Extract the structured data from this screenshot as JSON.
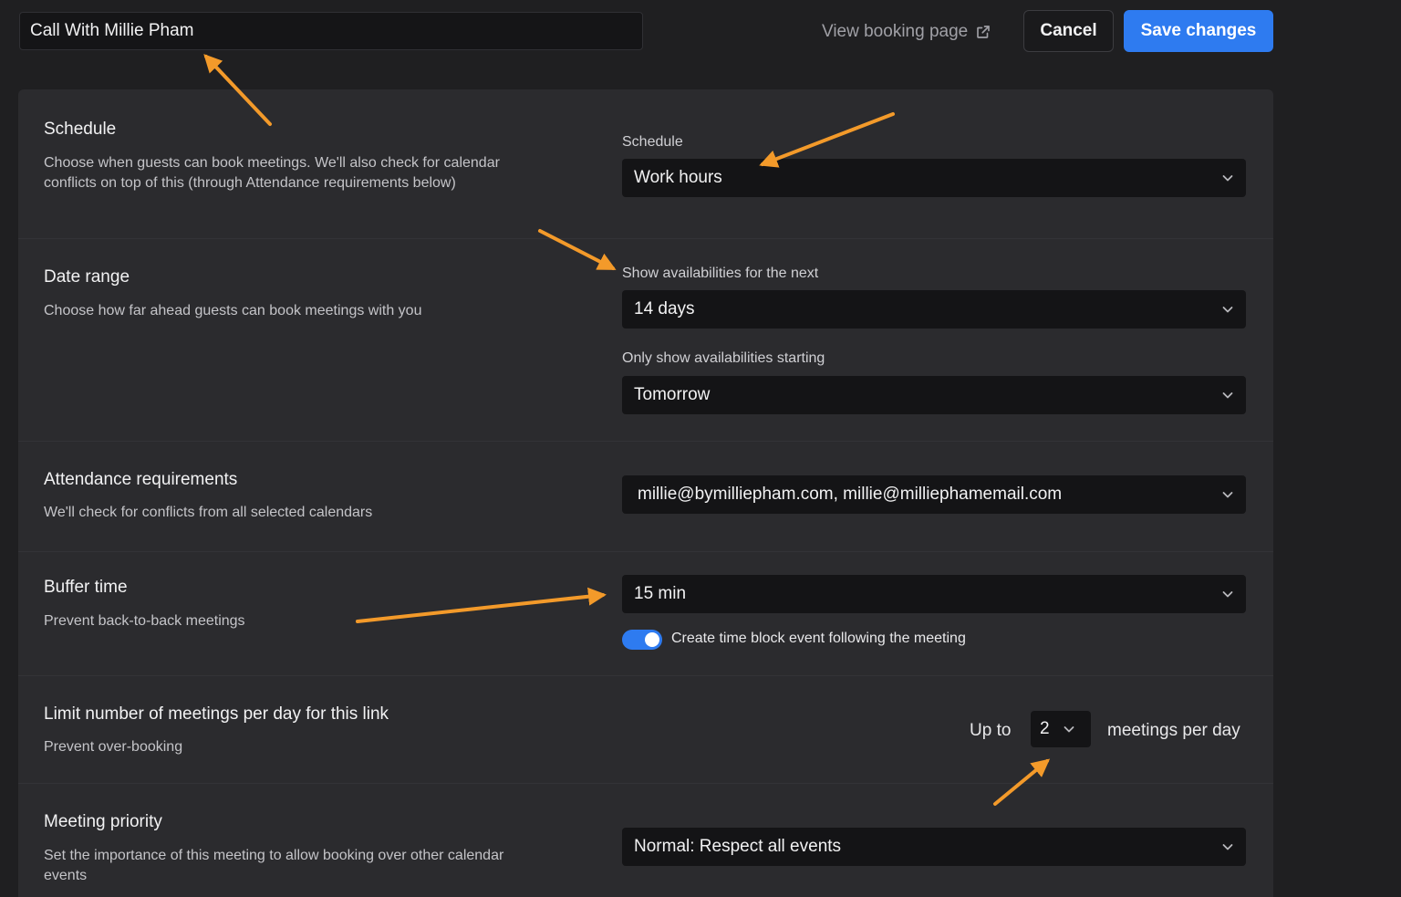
{
  "header": {
    "title_value": "Call With Millie Pham",
    "view_booking_label": "View booking page",
    "cancel_label": "Cancel",
    "save_label": "Save changes"
  },
  "sections": {
    "schedule": {
      "title": "Schedule",
      "description": "Choose when guests can book meetings. We'll also check for calendar conflicts on top of this (through Attendance requirements below)",
      "field_label": "Schedule",
      "value": "Work hours"
    },
    "date_range": {
      "title": "Date range",
      "description": "Choose how far ahead guests can book meetings with you",
      "next_label": "Show availabilities for the next",
      "next_value": "14 days",
      "start_label": "Only show availabilities starting",
      "start_value": "Tomorrow"
    },
    "attendance": {
      "title": "Attendance requirements",
      "description": "We'll check for conflicts from all selected calendars",
      "value": "millie@bymilliepham.com, millie@milliephamemail.com"
    },
    "buffer": {
      "title": "Buffer time",
      "description": "Prevent back-to-back meetings",
      "value": "15 min",
      "toggle_label": "Create time block event following the meeting",
      "toggle_on": true
    },
    "limit": {
      "title": "Limit number of meetings per day for this link",
      "description": "Prevent over-booking",
      "prefix": "Up to",
      "value": "2",
      "suffix": "meetings per day"
    },
    "priority": {
      "title": "Meeting priority",
      "description": "Set the importance of this meeting to allow booking over other calendar events",
      "value": "Normal: Respect all events"
    }
  },
  "colors": {
    "accent": "#2e7bf0",
    "annotation_arrow": "#f39a2a"
  },
  "icons": {
    "external_link": "external-link-icon",
    "dropdown": "chevron-down-icon"
  }
}
